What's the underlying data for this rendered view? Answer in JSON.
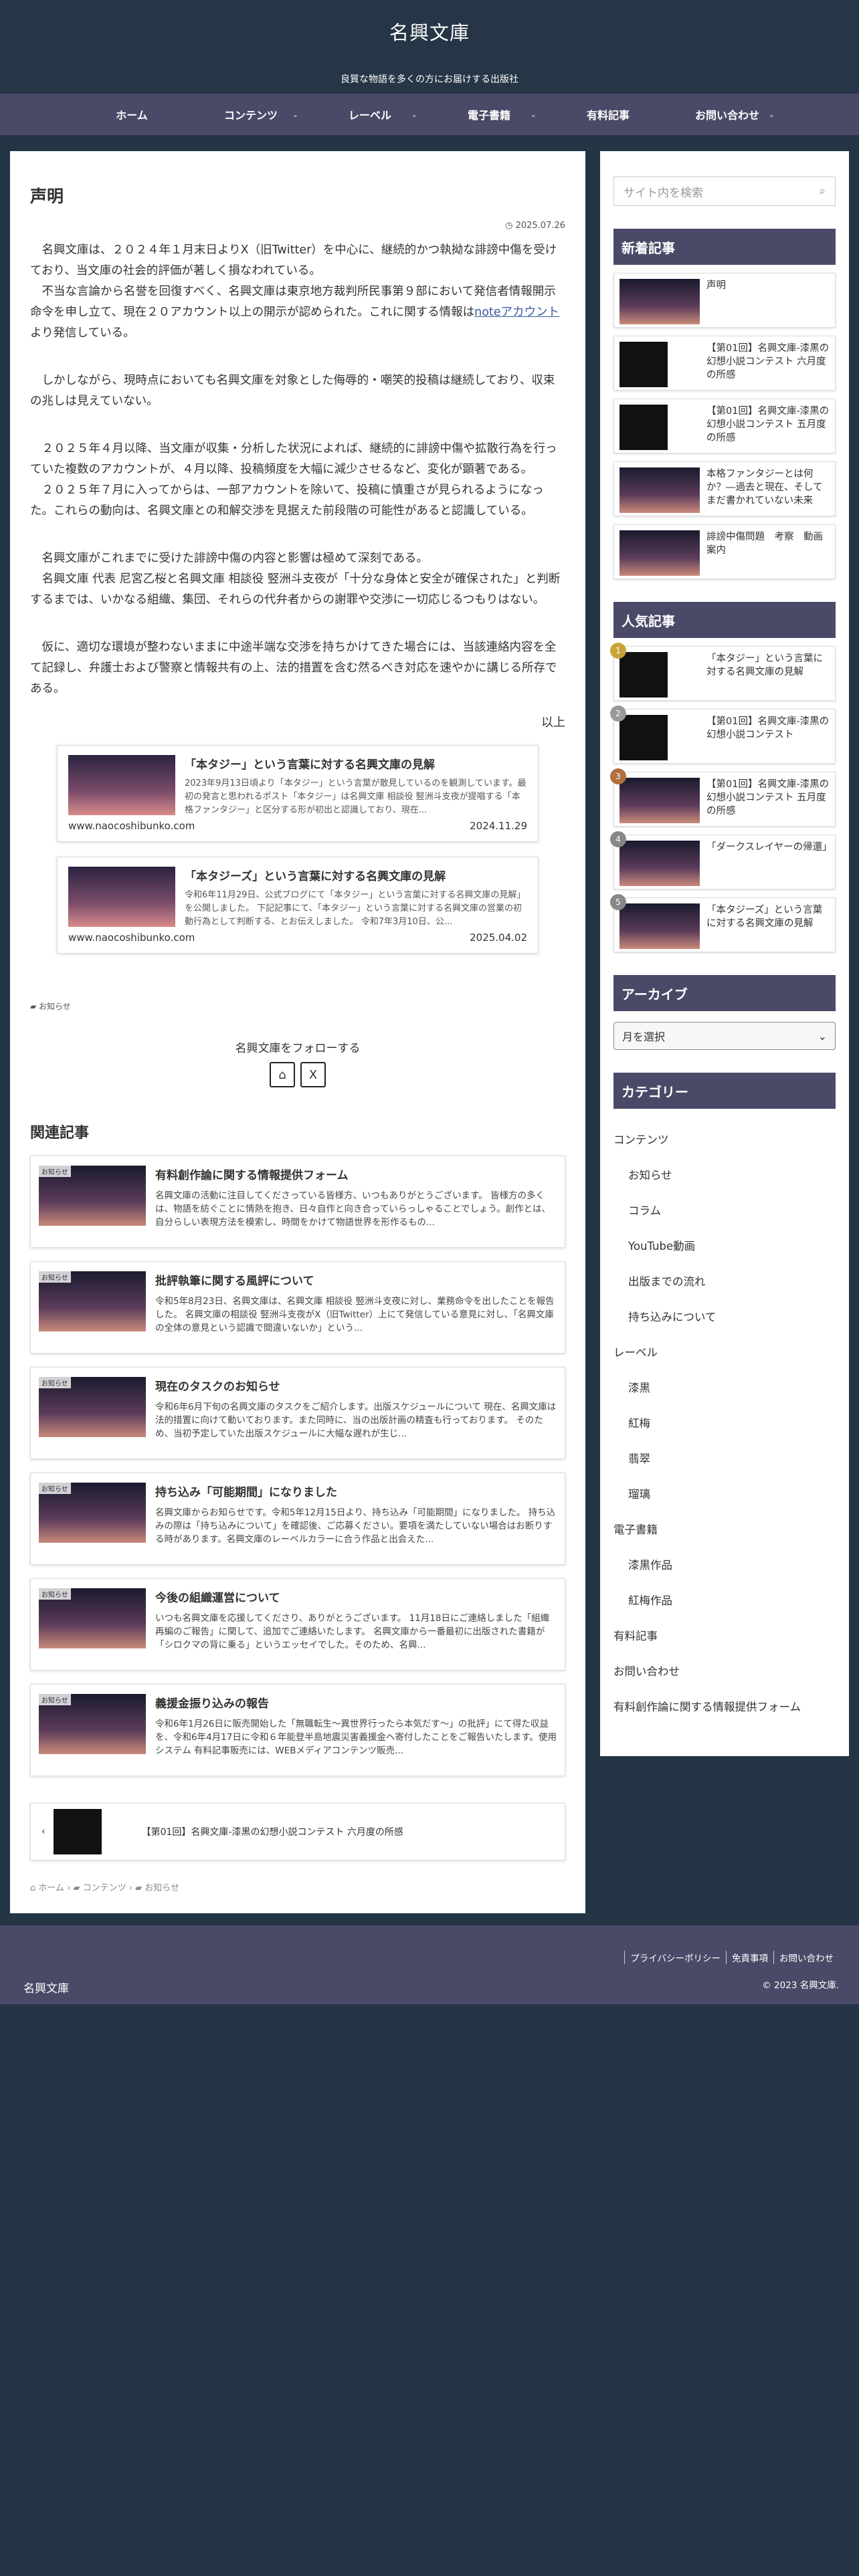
{
  "header": {
    "site_title": "名興文庫",
    "site_description": "良質な物語を多くの方にお届けする出版社"
  },
  "nav": [
    {
      "label": "ホーム",
      "has_children": false
    },
    {
      "label": "コンテンツ",
      "has_children": true
    },
    {
      "label": "レーベル",
      "has_children": true
    },
    {
      "label": "電子書籍",
      "has_children": true
    },
    {
      "label": "有料記事",
      "has_children": false
    },
    {
      "label": "お問い合わせ",
      "has_children": true
    }
  ],
  "post": {
    "title": "声明",
    "date": "2025.07.26",
    "paragraphs": [
      "名興文庫は、２０２４年１月末日よりX（旧Twitter）を中心に、継続的かつ執拗な誹謗中傷を受けており、当文庫の社会的評価が著しく損なわれている。",
      "不当な言論から名誉を回復すべく、名興文庫は東京地方裁判所民事第９部において発信者情報開示命令を申し立て、現在２０アカウント以上の開示が認められた。これに関する情報は",
      "しかしながら、現時点においても名興文庫を対象とした侮辱的・嘲笑的投稿は継続しており、収束の兆しは見えていない。",
      "２０２５年４月以降、当文庫が収集・分析した状況によれば、継続的に誹謗中傷や拡散行為を行っていた複数のアカウントが、４月以降、投稿頻度を大幅に減少させるなど、変化が顕著である。",
      "２０２５年７月に入ってからは、一部アカウントを除いて、投稿に慎重さが見られるようになった。これらの動向は、名興文庫との和解交渉を見据えた前段階の可能性があると認識している。",
      "名興文庫がこれまでに受けた誹謗中傷の内容と影響は極めて深刻である。",
      "名興文庫 代表 尼宮乙桜と名興文庫 相談役 竪洲斗支夜が「十分な身体と安全が確保された」と判断するまでは、いかなる組織、集団、それらの代弁者からの謝罪や交渉に一切応じるつもりはない。",
      "仮に、適切な環境が整わないままに中途半端な交渉を持ちかけてきた場合には、当該連絡内容を全て記録し、弁護士および警察と情報共有の上、法的措置を含む然るべき対応を速やかに講じる所存である。"
    ],
    "note_link": "noteアカウント",
    "note_link_suffix": "より発信している。",
    "end_mark": "以上",
    "category_tag": "お知らせ"
  },
  "link_cards": [
    {
      "title": "「本タジー」という言葉に対する名興文庫の見解",
      "snippet": "2023年9月13日頃より「本タジー」という言葉が散見しているのを観測しています。最初の発言と思われるポスト「本タジー」は名興文庫 相談役 竪洲斗支夜が提唱する「本格ファンタジー」と区分する形が初出と認識しており、現在...",
      "domain": "www.naocoshibunko.com",
      "date": "2024.11.29"
    },
    {
      "title": "「本タジーズ」という言葉に対する名興文庫の見解",
      "snippet": "令和6年11月29日、公式ブログにて「本タジー」という言葉に対する名興文庫の見解」を公開しました。 下記記事にて、「本タジー」という言葉に対する名興文庫の営業の初動行為として判断する、とお伝えしました。 令和7年3月10日、公...",
      "domain": "www.naocoshibunko.com",
      "date": "2025.04.02"
    }
  ],
  "follow": {
    "label": "名興文庫をフォローする"
  },
  "related": {
    "heading": "関連記事",
    "items": [
      {
        "title": "有料創作論に関する情報提供フォーム",
        "snippet": "名興文庫の活動に注目してくださっている皆様方、いつもありがとうございます。 皆様方の多くは、物語を紡ぐことに情熱を抱き、日々自作と向き合っていらっしゃることでしょう。創作とは、自分らしい表現方法を模索し、時間をかけて物語世界を形作るもの...",
        "tag": "お知らせ"
      },
      {
        "title": "批評執筆に関する風評について",
        "snippet": "令和5年8月23日、名興文庫は、名興文庫 相談役 竪洲斗支夜に対し、業務命令を出したことを報告した。 名興文庫の相談役 竪洲斗支夜がX（旧Twitter）上にて発信している意見に対し、「名興文庫の全体の意見という認識で間違いないか」という...",
        "tag": "お知らせ"
      },
      {
        "title": "現在のタスクのお知らせ",
        "snippet": "令和6年6月下旬の名興文庫のタスクをご紹介します。出版スケジュールについて 現在、名興文庫は法的措置に向けて動いております。また同時に、当の出版計画の精査も行っております。 そのため、当初予定していた出版スケジュールに大幅な遅れが生じ...",
        "tag": "お知らせ"
      },
      {
        "title": "持ち込み「可能期間」になりました",
        "snippet": "名興文庫からお知らせです。令和5年12月15日より、持ち込み「可能期間」になりました。 持ち込みの際は「持ち込みについて」を確認後、ご応募ください。要項を満たしていない場合はお断りする時があります。名興文庫のレーベルカラーに合う作品と出会えた...",
        "tag": "お知らせ"
      },
      {
        "title": "今後の組織運営について",
        "snippet": "いつも名興文庫を応援してくださり、ありがとうございます。 11月18日にご連絡しました「組織再編のご報告」に関して、追加でご連絡いたします。 名興文庫から一番最初に出版された書籍が「シロクマの背に乗る」というエッセイでした。そのため、名興...",
        "tag": "お知らせ"
      },
      {
        "title": "義援金振り込みの報告",
        "snippet": "令和6年1月26日に販売開始した「無職転生〜異世界行ったら本気だす〜」の批評」にて得た収益を、令和6年4月17日に令和６年能登半島地震災害義援金へ寄付したことをご報告いたします。使用システム 有料記事販売には、WEBメディアコンテンツ販売...",
        "tag": "お知らせ"
      }
    ]
  },
  "prev_post": {
    "label": "【第01回】名興文庫-漆黒の幻想小説コンテスト 六月度の所感"
  },
  "breadcrumb": [
    "ホーム",
    "コンテンツ",
    "お知らせ"
  ],
  "sidebar": {
    "search_placeholder": "サイト内を検索",
    "new_posts_heading": "新着記事",
    "new_posts": [
      "声明",
      "【第01回】名興文庫-漆黒の幻想小説コンテスト 六月度の所感",
      "【第01回】名興文庫-漆黒の幻想小説コンテスト 五月度の所感",
      "本格ファンタジーとは何か？―過去と現在、そしてまだ書かれていない未来",
      "誹謗中傷問題　考察　動画案内"
    ],
    "popular_heading": "人気記事",
    "popular_posts": [
      {
        "rank": "1",
        "title": "「本タジー」という言葉に対する名興文庫の見解"
      },
      {
        "rank": "2",
        "title": "【第01回】名興文庫-漆黒の幻想小説コンテスト"
      },
      {
        "rank": "3",
        "title": "【第01回】名興文庫-漆黒の幻想小説コンテスト 五月度の所感"
      },
      {
        "rank": "4",
        "title": "「ダークスレイヤーの帰還」"
      },
      {
        "rank": "5",
        "title": "「本タジーズ」という言葉に対する名興文庫の見解"
      }
    ],
    "archive_heading": "アーカイブ",
    "archive_select": "月を選択",
    "category_heading": "カテゴリー",
    "categories": [
      {
        "label": "コンテンツ",
        "sub": false
      },
      {
        "label": "お知らせ",
        "sub": true
      },
      {
        "label": "コラム",
        "sub": true
      },
      {
        "label": "YouTube動画",
        "sub": true
      },
      {
        "label": "出版までの流れ",
        "sub": true
      },
      {
        "label": "持ち込みについて",
        "sub": true
      },
      {
        "label": "レーベル",
        "sub": false
      },
      {
        "label": "漆黒",
        "sub": true
      },
      {
        "label": "紅梅",
        "sub": true
      },
      {
        "label": "翡翠",
        "sub": true
      },
      {
        "label": "瑠璃",
        "sub": true
      },
      {
        "label": "電子書籍",
        "sub": false
      },
      {
        "label": "漆黒作品",
        "sub": true
      },
      {
        "label": "紅梅作品",
        "sub": true
      },
      {
        "label": "有料記事",
        "sub": false
      },
      {
        "label": "お問い合わせ",
        "sub": false
      },
      {
        "label": "有料創作論に関する情報提供フォーム",
        "sub": false
      }
    ]
  },
  "footer": {
    "site": "名興文庫",
    "links": [
      "プライバシーポリシー",
      "免責事項",
      "お問い合わせ"
    ],
    "copyright": "© 2023 名興文庫."
  },
  "colors": {
    "header_bg": "#263646",
    "nav_bg": "#4a4a68",
    "widget_heading_bg": "#4a4a68",
    "link": "#3a5aa0"
  }
}
